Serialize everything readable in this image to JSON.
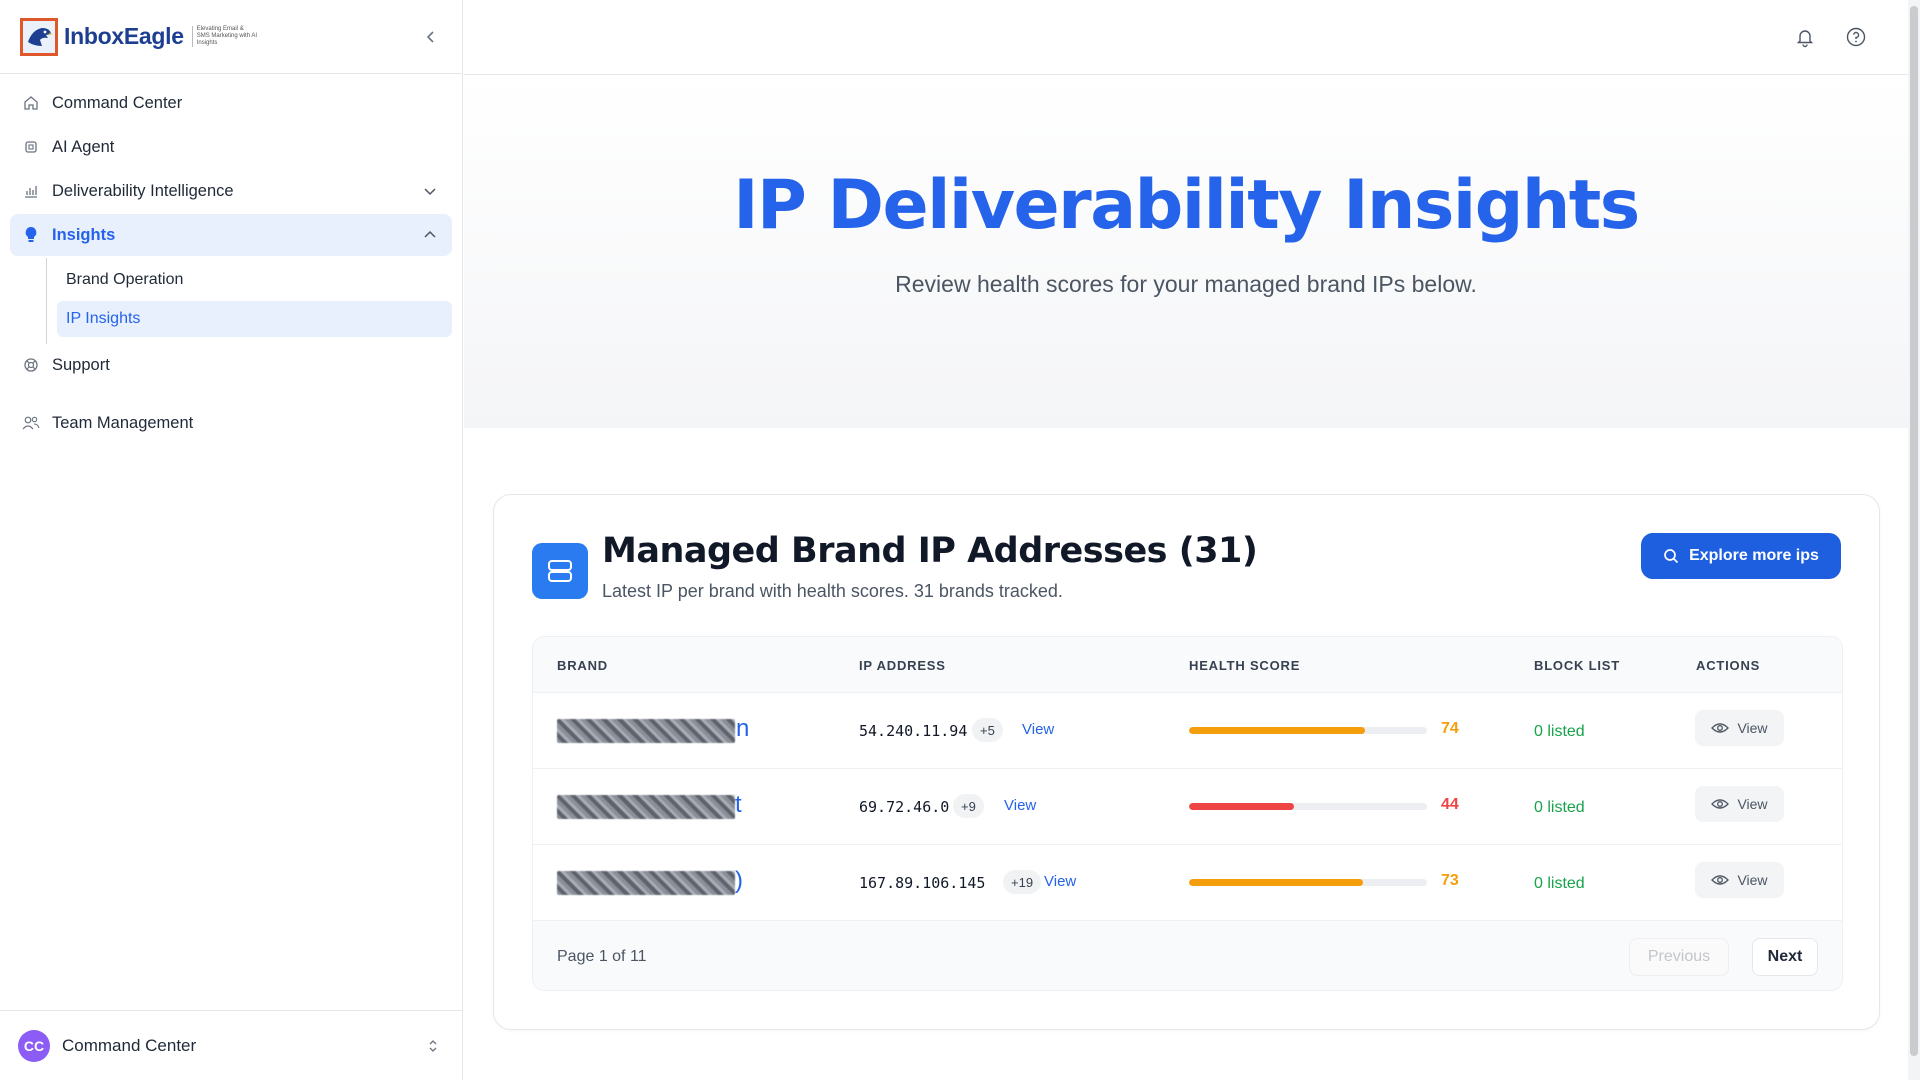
{
  "app": {
    "logo_text": "InboxEagle",
    "logo_tagline": "Elevating Email & SMS Marketing with AI Insights"
  },
  "sidebar": {
    "items": [
      {
        "label": "Command Center",
        "icon": "home-icon"
      },
      {
        "label": "AI Agent",
        "icon": "cpu-icon"
      },
      {
        "label": "Deliverability Intelligence",
        "icon": "bar-chart-icon"
      },
      {
        "label": "Insights",
        "icon": "lightbulb-icon"
      },
      {
        "label": "Support",
        "icon": "lifebuoy-icon"
      },
      {
        "label": "Team Management",
        "icon": "users-icon"
      }
    ],
    "insights_sub": [
      {
        "label": "Brand Operation"
      },
      {
        "label": "IP Insights"
      }
    ],
    "footer": {
      "avatar_initials": "CC",
      "label": "Command Center"
    }
  },
  "hero": {
    "title": "IP Deliverability Insights",
    "subtitle": "Review health scores for your managed brand IPs below."
  },
  "card": {
    "title": "Managed Brand IP Addresses (31)",
    "subtitle": "Latest IP per brand with health scores. 31 brands tracked.",
    "explore_label": "Explore more ips"
  },
  "table": {
    "headers": {
      "brand": "BRAND",
      "ip": "IP ADDRESS",
      "health": "HEALTH SCORE",
      "block": "BLOCK LIST",
      "actions": "ACTIONS"
    },
    "rows": [
      {
        "brand_tail": "n",
        "ip": "54.240.11.94",
        "extra": "+5",
        "ip_view": "View",
        "score": "74",
        "score_fraction": 0.74,
        "block": "0 listed",
        "action": "View"
      },
      {
        "brand_tail": "t",
        "ip": "69.72.46.0",
        "extra": "+9",
        "ip_view": "View",
        "score": "44",
        "score_fraction": 0.44,
        "block": "0 listed",
        "action": "View"
      },
      {
        "brand_tail": ")",
        "ip": "167.89.106.145",
        "extra": "+19",
        "ip_view": "View",
        "score": "73",
        "score_fraction": 0.73,
        "block": "0 listed",
        "action": "View"
      }
    ],
    "page_info": "Page 1 of 11",
    "prev_label": "Previous",
    "next_label": "Next"
  },
  "colors": {
    "accent": "#2563eb",
    "score_good": "#f59e0b",
    "score_bad": "#ef4444",
    "listed_ok": "#16a34a"
  }
}
